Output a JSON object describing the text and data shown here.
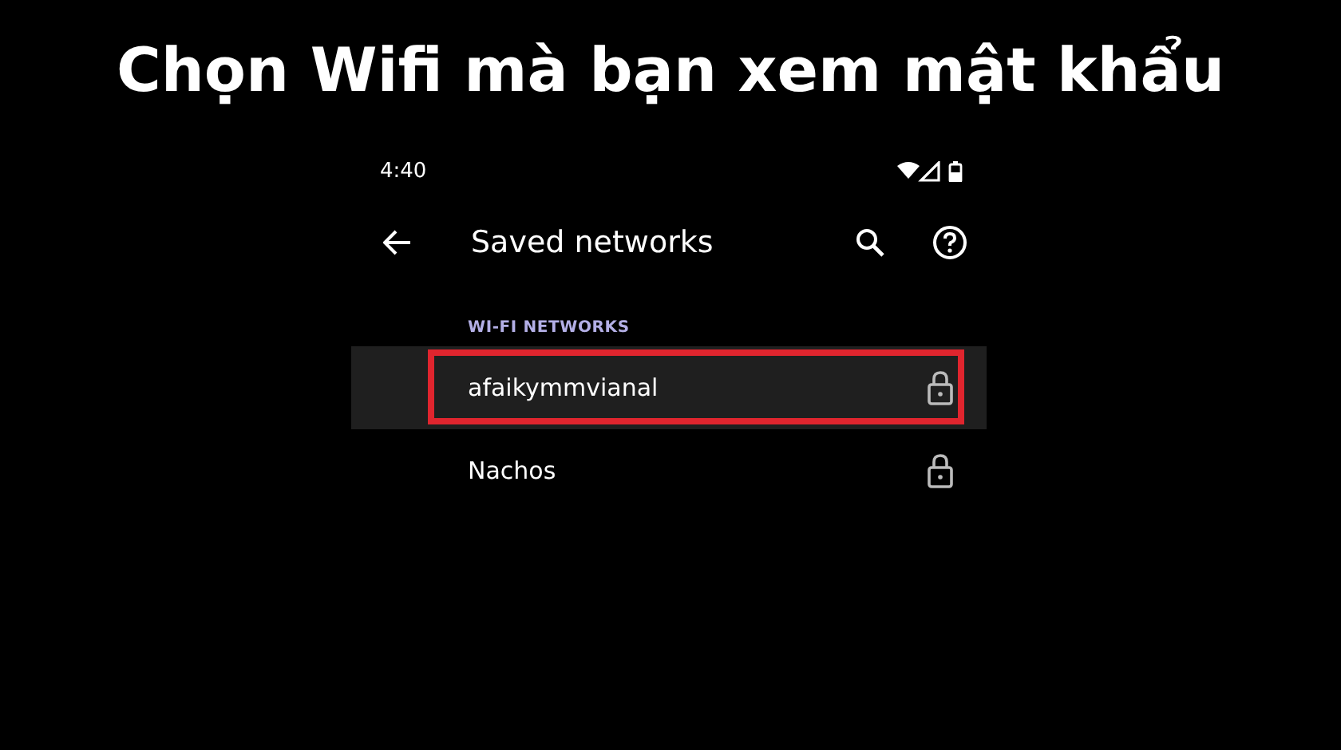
{
  "headline": "Chọn Wifi mà bạn xem mật khẩu",
  "status_bar": {
    "time": "4:40"
  },
  "toolbar": {
    "title": "Saved networks"
  },
  "section": {
    "title": "WI-FI NETWORKS"
  },
  "networks": [
    {
      "name": "afaikymmvianal",
      "selected": true
    },
    {
      "name": "Nachos",
      "selected": false
    }
  ]
}
